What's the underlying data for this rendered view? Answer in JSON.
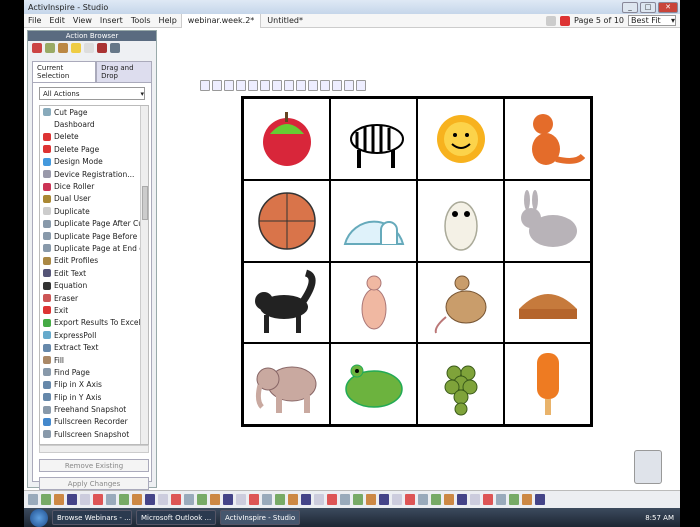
{
  "window": {
    "title": "ActivInspire - Studio"
  },
  "menu": [
    "File",
    "Edit",
    "View",
    "Insert",
    "Tools",
    "Help"
  ],
  "doc_tabs": [
    "webinar.week.2*",
    "Untitled*"
  ],
  "page_info": "Page 5 of 10",
  "zoom_select": "Best Fit",
  "panel": {
    "title": "Action Browser",
    "tabs": [
      "Current Selection",
      "Drag and Drop"
    ],
    "filter": "All Actions",
    "items": [
      "Cut Page",
      "Dashboard",
      "Delete",
      "Delete Page",
      "Design Mode",
      "Device Registration...",
      "Dice Roller",
      "Dual User",
      "Duplicate",
      "Duplicate Page After Cu",
      "Duplicate Page Before C",
      "Duplicate Page at End c",
      "Edit Profiles",
      "Edit Text",
      "Equation",
      "Eraser",
      "Exit",
      "Export Results To Excel",
      "ExpressPoll",
      "Extract Text",
      "Fill",
      "Find Page",
      "Flip in X Axis",
      "Flip in Y Axis",
      "Freehand Snapshot",
      "Fullscreen Recorder",
      "Fullscreen Snapshot"
    ],
    "remove_button": "Remove Existing",
    "apply_button": "Apply Changes"
  },
  "grid": [
    "apple",
    "zebra",
    "sun",
    "fox",
    "basketball",
    "igloo",
    "owl",
    "rabbit",
    "skunk",
    "kangaroo",
    "mouse",
    "pie",
    "elephant",
    "frog",
    "grapes",
    "popsicle"
  ],
  "taskbar": {
    "tasks": [
      "Browse Webinars - ...",
      "Microsoft Outlook ...",
      "ActivInspire - Studio"
    ],
    "clock": "8:57 AM"
  }
}
